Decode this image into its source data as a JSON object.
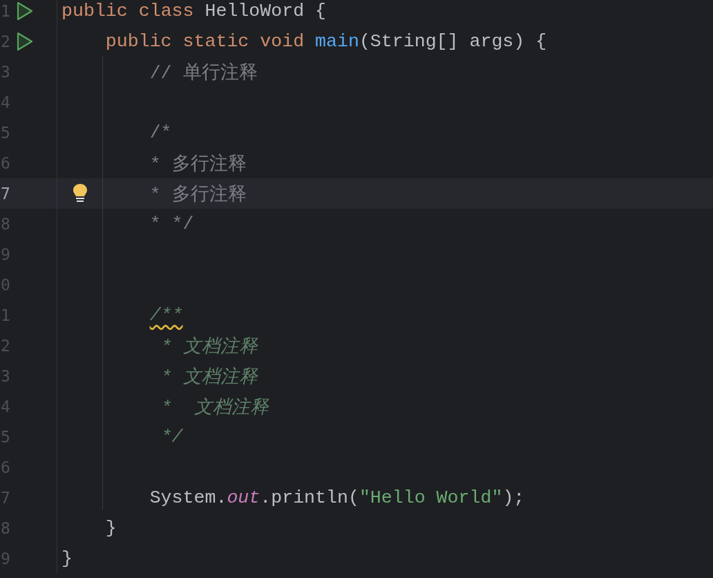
{
  "editor": {
    "lines": [
      {
        "number": "1",
        "run_marker": true,
        "tokens": [
          {
            "kind": "keyword",
            "text": "public class "
          },
          {
            "kind": "plain",
            "text": "HelloWord {"
          }
        ],
        "children": [
          {
            "number": "2",
            "run_marker": true,
            "tokens": [
              {
                "kind": "keyword",
                "text": "public static void "
              },
              {
                "kind": "method",
                "text": "main"
              },
              {
                "kind": "plain",
                "text": "(String[] args) {"
              }
            ],
            "children": [
              {
                "number": "3",
                "tokens": [
                  {
                    "kind": "comment",
                    "text": "// 单行注释"
                  }
                ]
              },
              {
                "number": "4"
              },
              {
                "number": "5",
                "tokens": [
                  {
                    "kind": "comment",
                    "text": "/*"
                  }
                ]
              },
              {
                "number": "6",
                "tokens": [
                  {
                    "kind": "comment",
                    "text": "* 多行注释"
                  }
                ]
              },
              {
                "number": "7",
                "current": true,
                "bulb": true,
                "tokens": [
                  {
                    "kind": "comment",
                    "text": "* 多行注释"
                  }
                ]
              },
              {
                "number": "8",
                "tokens": [
                  {
                    "kind": "comment",
                    "text": "* */"
                  }
                ]
              },
              {
                "number": "9"
              },
              {
                "number": "0"
              },
              {
                "number": "1",
                "tokens": [
                  {
                    "kind": "doc",
                    "text": "/**",
                    "warning": true
                  }
                ]
              },
              {
                "number": "2",
                "kind": "doc_body",
                "tokens": [
                  {
                    "kind": "doc",
                    "text": "* 文档注释"
                  }
                ]
              },
              {
                "number": "3",
                "kind": "doc_body",
                "tokens": [
                  {
                    "kind": "doc",
                    "text": "* 文档注释"
                  }
                ]
              },
              {
                "number": "4",
                "kind": "doc_body",
                "tokens": [
                  {
                    "kind": "doc",
                    "text": "*  文档注释"
                  }
                ]
              },
              {
                "number": "5",
                "kind": "doc_body",
                "tokens": [
                  {
                    "kind": "doc",
                    "text": "*/"
                  }
                ]
              },
              {
                "number": "6"
              },
              {
                "number": "7",
                "tokens": [
                  {
                    "kind": "plain",
                    "text": "System."
                  },
                  {
                    "kind": "field",
                    "text": "out"
                  },
                  {
                    "kind": "plain",
                    "text": ".println("
                  },
                  {
                    "kind": "string",
                    "text": "\"Hello World\""
                  },
                  {
                    "kind": "plain",
                    "text": ");"
                  }
                ]
              }
            ]
          },
          {
            "number": "8",
            "tokens": [
              {
                "kind": "plain",
                "text": "}"
              }
            ]
          }
        ]
      },
      {
        "number": "9",
        "tokens": [
          {
            "kind": "plain",
            "text": "}"
          }
        ]
      }
    ]
  }
}
